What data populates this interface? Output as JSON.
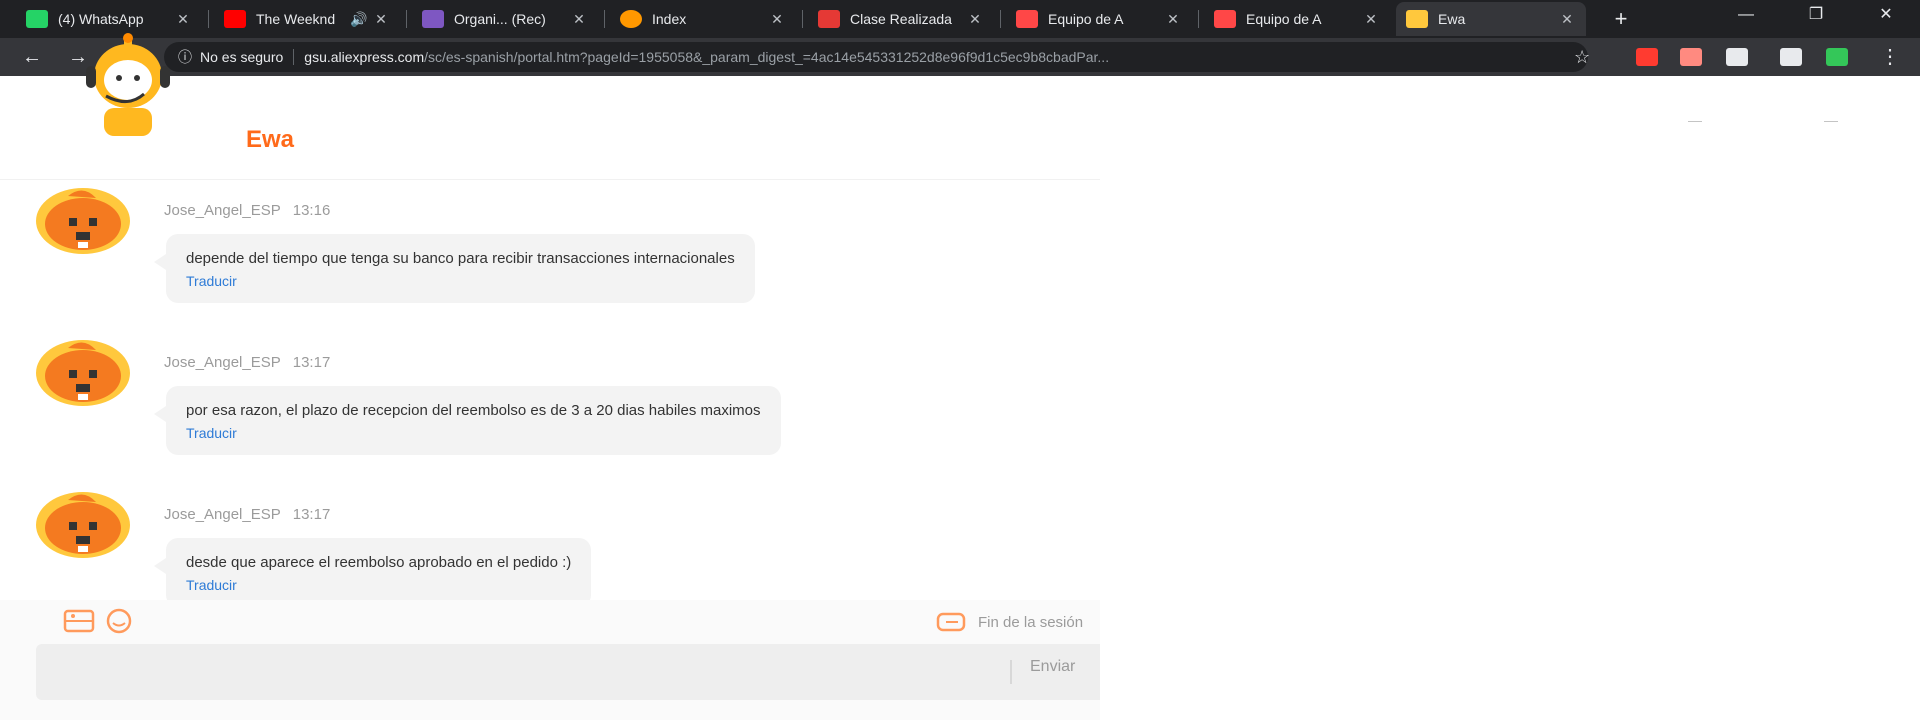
{
  "browser": {
    "tabs": [
      {
        "title": "(4) WhatsApp",
        "icon": "whatsapp-icon",
        "color": "#25d366"
      },
      {
        "title": "The Weeknd",
        "icon": "youtube-icon",
        "color": "#ff0000"
      },
      {
        "title": "Organi... (Rec)",
        "icon": "tab-icon",
        "color": "#7e57c2"
      },
      {
        "title": "Index",
        "icon": "tab-icon",
        "color": "#ff9800"
      },
      {
        "title": "Clase Realizada",
        "icon": "tab-icon",
        "color": "#e53935"
      },
      {
        "title": "Equipo de A",
        "icon": "aliexpress-icon",
        "color": "#ff4747"
      },
      {
        "title": "Equipo de A",
        "icon": "aliexpress-icon",
        "color": "#ff4747"
      },
      {
        "title": "Ewa",
        "icon": "ewa-icon",
        "color": "#ffc83d"
      }
    ],
    "new_tab": "+",
    "window_buttons": [
      "—",
      "❐",
      "✕"
    ],
    "address": {
      "security": "No es seguro",
      "domain": "gsu.aliexpress.com",
      "path": "/sc/es-spanish/portal.htm?pageId=1955058&_param_digest_=4ac14e545331252d8e96f9d1c5ec9b8cbadPar..."
    },
    "extension_colors": [
      "#ff3b30",
      "#ff8a80",
      "#e8eaed",
      "#e8eaed",
      "#34c759"
    ]
  },
  "chat": {
    "bot_name": "Ewa",
    "header_controls": [
      "—",
      "—"
    ],
    "messages": [
      {
        "author": "Jose_Angel_ESP",
        "time": "13:16",
        "text": "depende del tiempo que tenga su banco para recibir transacciones internacionales",
        "translate": "Traducir"
      },
      {
        "author": "Jose_Angel_ESP",
        "time": "13:17",
        "text": "por esa razon, el plazo de recepcion del reembolso es de 3 a 20 dias habiles maximos",
        "translate": "Traducir"
      },
      {
        "author": "Jose_Angel_ESP",
        "time": "13:17",
        "text": "desde que aparece el reembolso aprobado en el pedido :)",
        "translate": "Traducir"
      }
    ],
    "footer": {
      "end_session": "Fin de la sesión",
      "input_value": "",
      "send_label": "Enviar"
    },
    "colors": {
      "accent": "#ff6a1a",
      "link": "#2e7bd6",
      "bubble": "#f3f3f3"
    }
  }
}
